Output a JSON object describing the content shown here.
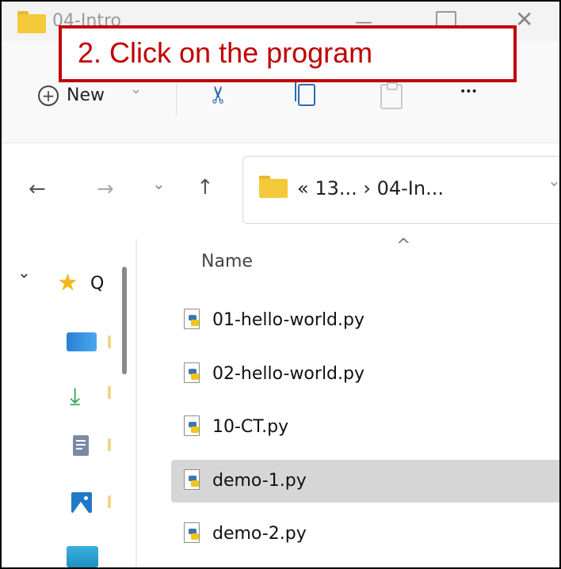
{
  "window": {
    "title": "04-Intro"
  },
  "callout": {
    "text": "2. Click on the program"
  },
  "toolbar": {
    "new_label": "New",
    "new_chevron": "⌄",
    "cut_glyph": "✂",
    "more_glyph": "•••"
  },
  "titlebar": {
    "minimize_glyph": "—",
    "close_glyph": "✕"
  },
  "nav": {
    "back_glyph": "←",
    "forward_glyph": "→",
    "recent_glyph": "⌄",
    "up_glyph": "↑",
    "address_path": "«  13...  ›  04-In...",
    "address_chevron": "⌄"
  },
  "sidebar": {
    "expand_glyph": "⌄",
    "star_glyph": "★",
    "quick_access_label": "Q",
    "download_glyph": "⤓",
    "icons": [
      "desktop-icon",
      "downloads-icon",
      "documents-icon",
      "pictures-icon",
      "drive-icon"
    ]
  },
  "file_list": {
    "column_header": "Name",
    "sort_glyph": "^",
    "files": [
      {
        "name": "01-hello-world.py",
        "selected": false
      },
      {
        "name": "02-hello-world.py",
        "selected": false
      },
      {
        "name": "10-CT.py",
        "selected": false
      },
      {
        "name": "demo-1.py",
        "selected": true
      },
      {
        "name": "demo-2.py",
        "selected": false
      }
    ]
  },
  "colors": {
    "callout_red": "#c00000",
    "selection": "#d6d6d6",
    "folder_yellow": "#f4c93a",
    "star_yellow": "#f2b81d",
    "download_green": "#2e9e44"
  }
}
